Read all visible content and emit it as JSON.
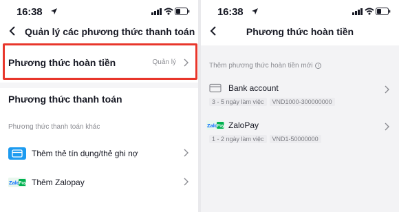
{
  "left_screen": {
    "status": {
      "time": "16:38"
    },
    "nav": {
      "title": "Quản lý các phương thức thanh toán"
    },
    "refund": {
      "title": "Phương thức hoàn tiền",
      "manage": "Quản lý"
    },
    "payment": {
      "title": "Phương thức thanh toán",
      "other_label": "Phương thức thanh toán khác",
      "options": [
        {
          "label": "Thêm thẻ tín dụng/thẻ ghi nợ",
          "icon": "credit-card-icon"
        },
        {
          "label": "Thêm Zalopay",
          "icon": "zalopay-icon"
        }
      ]
    },
    "highlight_color": "#e8362b"
  },
  "right_screen": {
    "status": {
      "time": "16:38"
    },
    "nav": {
      "title": "Phương thức hoàn tiền"
    },
    "sub_label": "Thêm phương thức hoàn tiền mới",
    "methods": [
      {
        "name": "Bank account",
        "icon": "bank-card-icon",
        "tags": [
          "3 - 5 ngày làm việc",
          "VND1000-300000000"
        ]
      },
      {
        "name": "ZaloPay",
        "icon": "zalopay-icon",
        "tags": [
          "1 - 2 ngày làm việc",
          "VND1-50000000"
        ]
      }
    ]
  }
}
